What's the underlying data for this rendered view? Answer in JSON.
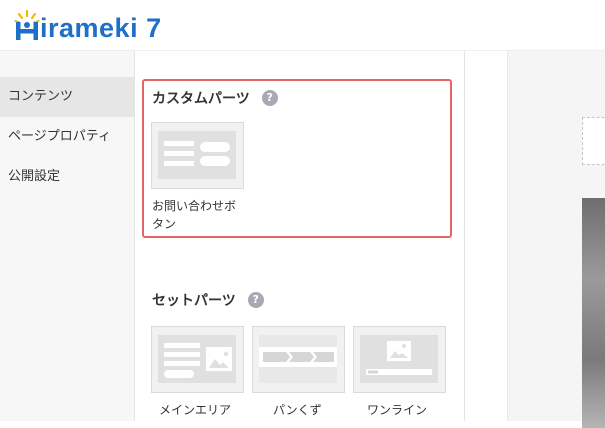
{
  "app": {
    "logo_text": "irameki 7"
  },
  "sidebar": {
    "items": [
      {
        "label": "コンテンツ"
      },
      {
        "label": "ページプロパティ"
      },
      {
        "label": "公開設定"
      }
    ]
  },
  "custom_parts": {
    "title": "カスタムパーツ",
    "help": "?",
    "items": [
      {
        "label_line1": "お問い合わせボ",
        "label_line2": "タン"
      }
    ]
  },
  "set_parts": {
    "title": "セットパーツ",
    "help": "?",
    "items": [
      {
        "label": "メインエリア"
      },
      {
        "label": "パンくず"
      },
      {
        "label": "ワンライン"
      }
    ]
  },
  "colors": {
    "brand": "#1f6fc8",
    "accent_border": "#e36565",
    "logo_rays": "#f5b800"
  }
}
